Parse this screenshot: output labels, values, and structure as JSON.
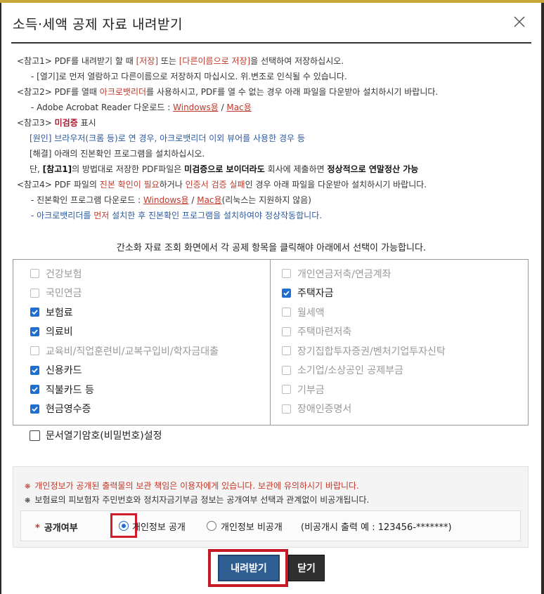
{
  "dialog": {
    "title": "소득·세액 공제 자료 내려받기",
    "close_icon": "close-icon"
  },
  "notes": {
    "n1": {
      "prefix": "<참고1> PDF를 내려받기 할 때 ",
      "save": "[저장]",
      "mid": " 또는 ",
      "save_as": "[다른이름으로 저장]",
      "suffix": "을 선택하여 저장하십시오.",
      "sub": "- [열기]로 먼저 열람하고 다른이름으로 저장하지 마십시오. 위.변조로 인식될 수 있습니다."
    },
    "n2": {
      "prefix": "<참고2> PDF를 열때 ",
      "acrobat": "아크로뱃리더",
      "suffix": "를 사용하시고, PDF를 열 수 없는 경우 아래 파일을 다운받아 설치하시기 바랍니다.",
      "sub_prefix": "- Adobe Acrobat Reader 다운로드 : ",
      "windows": "Windows용",
      "sep": " / ",
      "mac": "Mac용"
    },
    "n3": {
      "prefix": "<참고3> ",
      "unverified": "미검증",
      "suffix": " 표시",
      "cause": "[원인] 브라우저(크롬 등)로 연 경우, 아크로뱃리더 이외 뷰어를 사용한 경우 등",
      "fix": "[해결] 아래의 진본확인 프로그램을 설치하십시오.",
      "note_a": "단, ",
      "note_ref": "[참고1]",
      "note_b": "의 방법대로 저장한 PDF파일은 ",
      "note_c": "미검증으로 보이더라도",
      "note_d": " 회사에 제출하면 ",
      "note_e": "정상적으로 연말정산 가능"
    },
    "n4": {
      "prefix": "<참고4> PDF 파일의 ",
      "verify": "진본 확인이 필요",
      "mid": "하거나 ",
      "cert": "인증서 검증 실패",
      "suffix": "인 경우 아래 파일을 다운받아 설치하시기 바랍니다.",
      "sub1_prefix": "- 진본확인 프로그램 다운로드 : ",
      "windows": "Windows용",
      "sep": " / ",
      "mac": "Mac용",
      "sub1_suffix": "(리눅스는 지원하지 않음)",
      "sub2_a": "- 아크로뱃리더를 ",
      "sub2_first": "먼저",
      "sub2_b": " 설치한 후 진본확인 프로그램을 설치하여야 정상작동합니다."
    }
  },
  "hint": "간소화 자료 조회 화면에서 각 공제 항목을 클릭해야 아래에서 선택이 가능합니다.",
  "left_items": [
    {
      "label": "건강보험",
      "checked": false
    },
    {
      "label": "국민연금",
      "checked": false
    },
    {
      "label": "보험료",
      "checked": true
    },
    {
      "label": "의료비",
      "checked": true
    },
    {
      "label": "교육비/직업훈련비/교복구입비/학자금대출",
      "checked": false
    },
    {
      "label": "신용카드",
      "checked": true
    },
    {
      "label": "직불카드 등",
      "checked": true
    },
    {
      "label": "현금영수증",
      "checked": true
    }
  ],
  "right_items": [
    {
      "label": "개인연금저축/연금계좌",
      "checked": false
    },
    {
      "label": "주택자금",
      "checked": true
    },
    {
      "label": "월세액",
      "checked": false
    },
    {
      "label": "주택마련저축",
      "checked": false
    },
    {
      "label": "장기집합투자증권/벤처기업투자신탁",
      "checked": false
    },
    {
      "label": "소기업/소상공인 공제부금",
      "checked": false
    },
    {
      "label": "기부금",
      "checked": false
    },
    {
      "label": "장애인증명서",
      "checked": false
    }
  ],
  "password_option": "문서열기암호(비밀번호)설정",
  "privacy": {
    "note1": "개인정보가 공개된 출력물의 보관 책임은 이용자에게 있습니다. 보관에 유의하시기 바랍니다.",
    "note2": "보험료의 피보험자 주민번호와 정치자금기부금 정보는 공개여부 선택과 관계없이 비공개됩니다.",
    "label": "공개여부",
    "option_public": "개인정보 공개",
    "option_private": "개인정보 비공개",
    "private_example": "(비공개시 출력 예 : 123456-*******)",
    "selected": "public"
  },
  "buttons": {
    "download": "내려받기",
    "close": "닫기"
  },
  "colors": {
    "accent_red": "#c0392b",
    "accent_blue": "#2c5aa0",
    "checkbox_blue": "#1f6fd1",
    "download_button": "#2f5e93",
    "highlight_box": "#d11a2a"
  }
}
